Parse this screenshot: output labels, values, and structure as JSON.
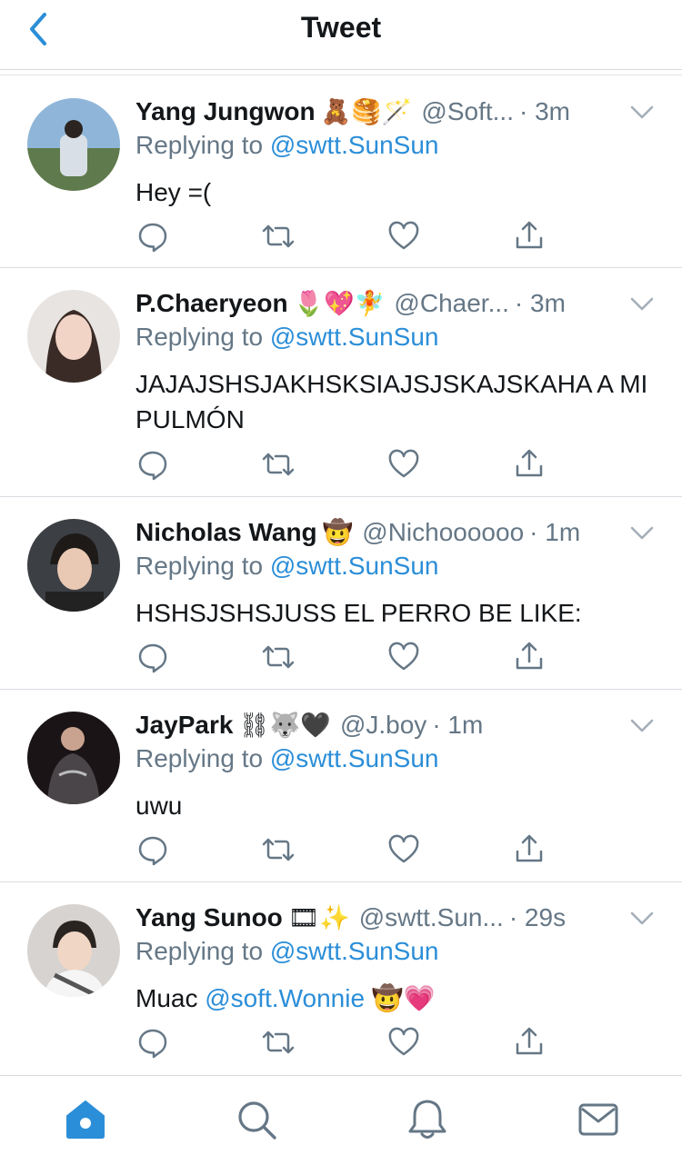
{
  "header": {
    "title": "Tweet",
    "back_icon": "chevron-left-icon"
  },
  "colors": {
    "accent": "#2b8ed8",
    "muted": "#657786",
    "text": "#14171a",
    "divider": "#d9dde1"
  },
  "tweets": [
    {
      "name": "Yang Jungwon",
      "emojis": "🧸🥞🪄",
      "handle": "@Soft...",
      "time": "· 3m",
      "replying_prefix": "Replying to ",
      "replying_to": "@swtt.SunSun",
      "text": "Hey =(",
      "text_mention": "",
      "text_suffix": ""
    },
    {
      "name": "P.Chaeryeon",
      "emojis": "🌷💖🧚",
      "handle": "@Chaer...",
      "time": "· 3m",
      "replying_prefix": "Replying to ",
      "replying_to": "@swtt.SunSun",
      "text": "JAJAJSHSJAKHSKSIAJSJSKAJSKAHA A MI PULMÓN",
      "text_mention": "",
      "text_suffix": ""
    },
    {
      "name": "Nicholas Wang",
      "emojis": "🤠",
      "handle": "@Nichoooooo",
      "time": "· 1m",
      "replying_prefix": "Replying to ",
      "replying_to": "@swtt.SunSun",
      "text": "HSHSJSHSJUSS EL PERRO BE LIKE:",
      "text_mention": "",
      "text_suffix": ""
    },
    {
      "name": "JayPark",
      "emojis": "⛓🐺🖤",
      "handle": "@J.boy",
      "time": "· 1m",
      "replying_prefix": "Replying to ",
      "replying_to": "@swtt.SunSun",
      "text": "uwu",
      "text_mention": "",
      "text_suffix": ""
    },
    {
      "name": "Yang Sunoo",
      "emojis": "🎞✨",
      "handle": "@swtt.Sun...",
      "time": "· 29s",
      "replying_prefix": "Replying to ",
      "replying_to": "@swtt.SunSun",
      "text": "Muac ",
      "text_mention": "@soft.Wonnie",
      "text_suffix": " 🤠💗"
    }
  ],
  "tabbar": {
    "items": [
      "home-icon",
      "search-icon",
      "notifications-icon",
      "messages-icon"
    ],
    "active": "home-icon"
  }
}
